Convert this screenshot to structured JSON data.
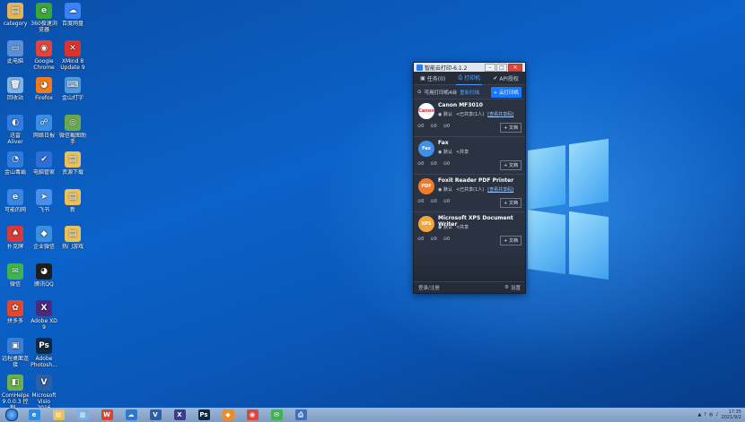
{
  "desktop": {
    "icons": [
      {
        "label": "category",
        "name": "category-icon",
        "color": "#e3b55a",
        "glyph": "▤"
      },
      {
        "label": "360极速浏览器",
        "name": "browser-360-icon",
        "color": "#3aa53a",
        "glyph": "e"
      },
      {
        "label": "百度网盘",
        "name": "baidu-pan-icon",
        "color": "#3b82f6",
        "glyph": "☁"
      },
      {
        "label": "此电脑",
        "name": "this-pc-icon",
        "color": "#5a8fd8",
        "glyph": "▭"
      },
      {
        "label": "Google Chrome",
        "name": "chrome-icon",
        "color": "#e0443a",
        "glyph": "◉"
      },
      {
        "label": "XMind 8 Update 9",
        "name": "xmind-icon",
        "color": "#d9342b",
        "glyph": "✕"
      },
      {
        "label": "回收站",
        "name": "recycle-bin-icon",
        "color": "#7fb4e6",
        "glyph": "🗑"
      },
      {
        "label": "Firefox",
        "name": "firefox-icon",
        "color": "#f07b1d",
        "glyph": "◕"
      },
      {
        "label": "金山打字",
        "name": "typing-icon",
        "color": "#4e9be0",
        "glyph": "⌨"
      },
      {
        "label": "迅雷 Aliver",
        "name": "aliver-icon",
        "color": "#2f7de1",
        "glyph": "◐"
      },
      {
        "label": "网络日报",
        "name": "network-icon",
        "color": "#3a8ee6",
        "glyph": "☍"
      },
      {
        "label": "微信截图助手",
        "name": "capture-icon",
        "color": "#6aa84f",
        "glyph": "◎"
      },
      {
        "label": "金山毒霸",
        "name": "antivirus-icon",
        "color": "#2e7be0",
        "glyph": "◔"
      },
      {
        "label": "电脑管家",
        "name": "pc-manager-icon",
        "color": "#2d6fd6",
        "glyph": "✔"
      },
      {
        "label": "资源下载",
        "name": "downloads-folder-icon",
        "color": "#e8c15a",
        "glyph": "▤"
      },
      {
        "label": "可能的网",
        "name": "web-icon",
        "color": "#3a86e0",
        "glyph": "e"
      },
      {
        "label": "飞书",
        "name": "feishu-icon",
        "color": "#4b90e8",
        "glyph": "➤"
      },
      {
        "label": "新",
        "name": "new-folder-icon",
        "color": "#e8c15a",
        "glyph": "▤"
      },
      {
        "label": "扑克牌",
        "name": "cards-icon",
        "color": "#d63a3a",
        "glyph": "♠"
      },
      {
        "label": "企业微信",
        "name": "wecom-icon",
        "color": "#3c8ee0",
        "glyph": "◆"
      },
      {
        "label": "热门游戏",
        "name": "games-folder-icon",
        "color": "#e8c15a",
        "glyph": "▤"
      },
      {
        "label": "微信",
        "name": "wechat-icon",
        "color": "#3fb34f",
        "glyph": "✉"
      },
      {
        "label": "腾讯QQ",
        "name": "qq-icon",
        "color": "#1d1d1d",
        "glyph": "◕"
      },
      {
        "label": "拼多多",
        "name": "pdd-icon",
        "color": "#e0492f",
        "glyph": "✿"
      },
      {
        "label": "Adobe XD 9",
        "name": "adobe-xd-icon",
        "color": "#4b2a7d",
        "glyph": "X"
      },
      {
        "label": "远程桌面连接",
        "name": "remote-desktop-icon",
        "color": "#3a7fd8",
        "glyph": "▣"
      },
      {
        "label": "Adobe Photosh...",
        "name": "photoshop-icon",
        "color": "#0d2a44",
        "glyph": "Ps"
      },
      {
        "label": "ComHelper 9.0.0.3 控制...",
        "name": "comhelper-icon",
        "color": "#6ab04c",
        "glyph": "◧"
      },
      {
        "label": "Microsoft Visio 2016",
        "name": "visio-icon",
        "color": "#2b5fa8",
        "glyph": "V"
      }
    ]
  },
  "app": {
    "title": "智能云打印-6.1.2",
    "tabs": [
      {
        "label": "任务(0)",
        "icon": "task-icon",
        "active": false
      },
      {
        "label": "打印机",
        "icon": "printer-icon",
        "active": true
      },
      {
        "label": "API授权",
        "icon": "shield-check-icon",
        "active": false
      }
    ],
    "available_label": "可用打印机4台",
    "rescan_label": "重新扫描",
    "cloud_button": "+ 云打印机",
    "printers": [
      {
        "name": "Canon MF3010",
        "avatar": "Canon",
        "avatar_bg": "#ffffff",
        "avatar_fg": "#d0232a",
        "default_label": "默认",
        "share_label": "已共享(1人)",
        "share_link": "[查看共享码]",
        "stats": [
          "0",
          "0",
          "0"
        ],
        "doc_label": "+ 文档"
      },
      {
        "name": "Fax",
        "avatar": "Fax",
        "avatar_bg": "#3f8ee8",
        "avatar_fg": "#ffffff",
        "default_label": "默认",
        "share_label": "共享",
        "share_link": "",
        "stats": [
          "0",
          "0",
          "0"
        ],
        "doc_label": "+ 文档"
      },
      {
        "name": "Foxit Reader PDF Printer",
        "avatar": "PDF",
        "avatar_bg": "#f07b2a",
        "avatar_fg": "#ffffff",
        "default_label": "默认",
        "share_label": "已共享(1人)",
        "share_link": "[查看共享码]",
        "stats": [
          "0",
          "0",
          "0"
        ],
        "doc_label": "+ 文档"
      },
      {
        "name": "Microsoft XPS Document Writer",
        "avatar": "XPS",
        "avatar_bg": "#f2a63a",
        "avatar_fg": "#ffffff",
        "default_label": "默认",
        "share_label": "共享",
        "share_link": "",
        "stats": [
          "0",
          "0",
          "0"
        ],
        "doc_label": "+ 文档"
      }
    ],
    "footer_left": "登录/注册",
    "footer_right": "设置"
  },
  "taskbar": {
    "apps": [
      {
        "name": "ie-task-icon",
        "glyph": "e",
        "color": "#2f8be0"
      },
      {
        "name": "explorer-task-icon",
        "glyph": "▤",
        "color": "#e8c15a"
      },
      {
        "name": "notes-task-icon",
        "glyph": "▥",
        "color": "#7bb0e0"
      },
      {
        "name": "wps-task-icon",
        "glyph": "W",
        "color": "#d9452e"
      },
      {
        "name": "cloud-task-icon",
        "glyph": "☁",
        "color": "#2b78d0"
      },
      {
        "name": "visio-task-icon",
        "glyph": "V",
        "color": "#2b5fa8"
      },
      {
        "name": "xmind-task-icon",
        "glyph": "X",
        "color": "#3c3c8a"
      },
      {
        "name": "photoshop-task-icon",
        "glyph": "Ps",
        "color": "#0d2a44"
      },
      {
        "name": "sublime-task-icon",
        "glyph": "◆",
        "color": "#f08a24"
      },
      {
        "name": "chrome-task-icon",
        "glyph": "◉",
        "color": "#e0443a"
      },
      {
        "name": "wechat-task-icon",
        "glyph": "✉",
        "color": "#3fb34f"
      },
      {
        "name": "print-task-icon",
        "glyph": "⎙",
        "color": "#3a6fc4"
      }
    ],
    "clock_time": "17:35",
    "clock_date": "2021/9/2"
  }
}
